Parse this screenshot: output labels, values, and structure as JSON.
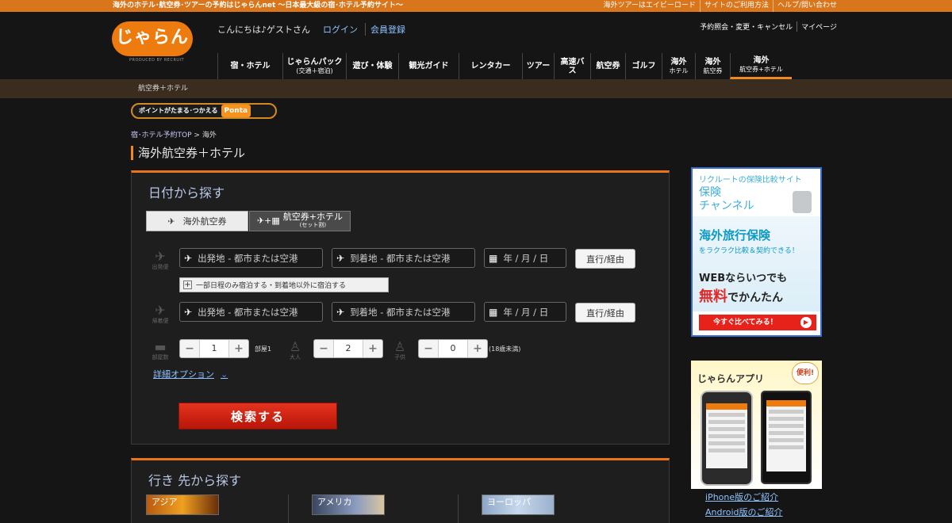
{
  "topbar": {
    "tagline": "海外のホテル･航空券･ツアーの予約はじゃらんnet 〜日本最大級の宿･ホテル予約サイト〜",
    "links": [
      "海外ツアーはエイビーロード",
      "サイトのご利用方法",
      "ヘルプ/問い合わせ"
    ]
  },
  "header": {
    "logo_text": "じゃらん",
    "logo_sub": "PRODUCED BY RECRUIT",
    "greeting": "こんにちは♪ゲストさん",
    "login": "ログイン",
    "register": "会員登録",
    "member_links": [
      "予約照会・変更・キャンセル",
      "マイページ"
    ]
  },
  "gnav": [
    {
      "label": "宿・ホテル",
      "sub": ""
    },
    {
      "label": "じゃらんパック",
      "sub": "(交通＋宿泊)"
    },
    {
      "label": "遊び・体験",
      "sub": ""
    },
    {
      "label": "観光ガイド",
      "sub": ""
    },
    {
      "label": "レンタカー",
      "sub": ""
    },
    {
      "label": "ツアー",
      "sub": ""
    },
    {
      "label": "高速バス",
      "sub": ""
    },
    {
      "label": "航空券",
      "sub": ""
    },
    {
      "label": "ゴルフ",
      "sub": ""
    },
    {
      "label": "海外",
      "sub": "ホテル"
    },
    {
      "label": "海外",
      "sub": "航空券"
    },
    {
      "label": "海外",
      "sub": "航空券+ホテル"
    }
  ],
  "subbar": "航空券＋ホテル",
  "ponta": {
    "text": "ポイントがたまる･つかえる",
    "badge": "Ponta"
  },
  "breadcrumb": {
    "link": "宿･ホテル予約TOP",
    "sep": ">",
    "current": "海外"
  },
  "page_title": "海外航空券＋ホテル",
  "date_search": {
    "heading": "日付から探す",
    "tab_flight": "海外航空券",
    "tab_set": "航空券+ホテル",
    "tab_set_sub": "(セット割)",
    "outbound_label": "出発便",
    "return_label": "帰着便",
    "rooms_label": "部屋数",
    "adults_label": "大人",
    "children_label": "子供",
    "from_placeholder": "出発地 - 都市または空港",
    "to_placeholder": "到着地 - 都市または空港",
    "date_placeholder": "年 / 月 / 日",
    "via_button": "直行/経由",
    "add_stay": "一部日程のみ宿泊する・到着地以外に宿泊する",
    "rooms_value": "1",
    "rooms_unit": "部屋1",
    "adults_value": "2",
    "children_value": "0",
    "children_note": "(18歳未満)",
    "detail_options": "詳細オプション",
    "search_button": "検索する"
  },
  "dest_search": {
    "heading": "行き 先から探す",
    "regions": [
      "アジア",
      "アメリカ",
      "ヨーロッパ"
    ]
  },
  "ad_insurance": {
    "line1": "リクルートの保険比較サイト",
    "brand1": "保険",
    "brand2": "チャンネル",
    "headline": "海外旅行保険",
    "sub": "をラクラク比較＆契約できる！",
    "line3": "WEBならいつでも",
    "free": "無料",
    "free_after": "でかんたん",
    "cta": "今すぐ比べてみる！"
  },
  "ad_app": {
    "title": "じゃらんアプリ",
    "badge": "便利!"
  },
  "app_links": [
    "iPhone版のご紹介",
    "Android版のご紹介"
  ]
}
